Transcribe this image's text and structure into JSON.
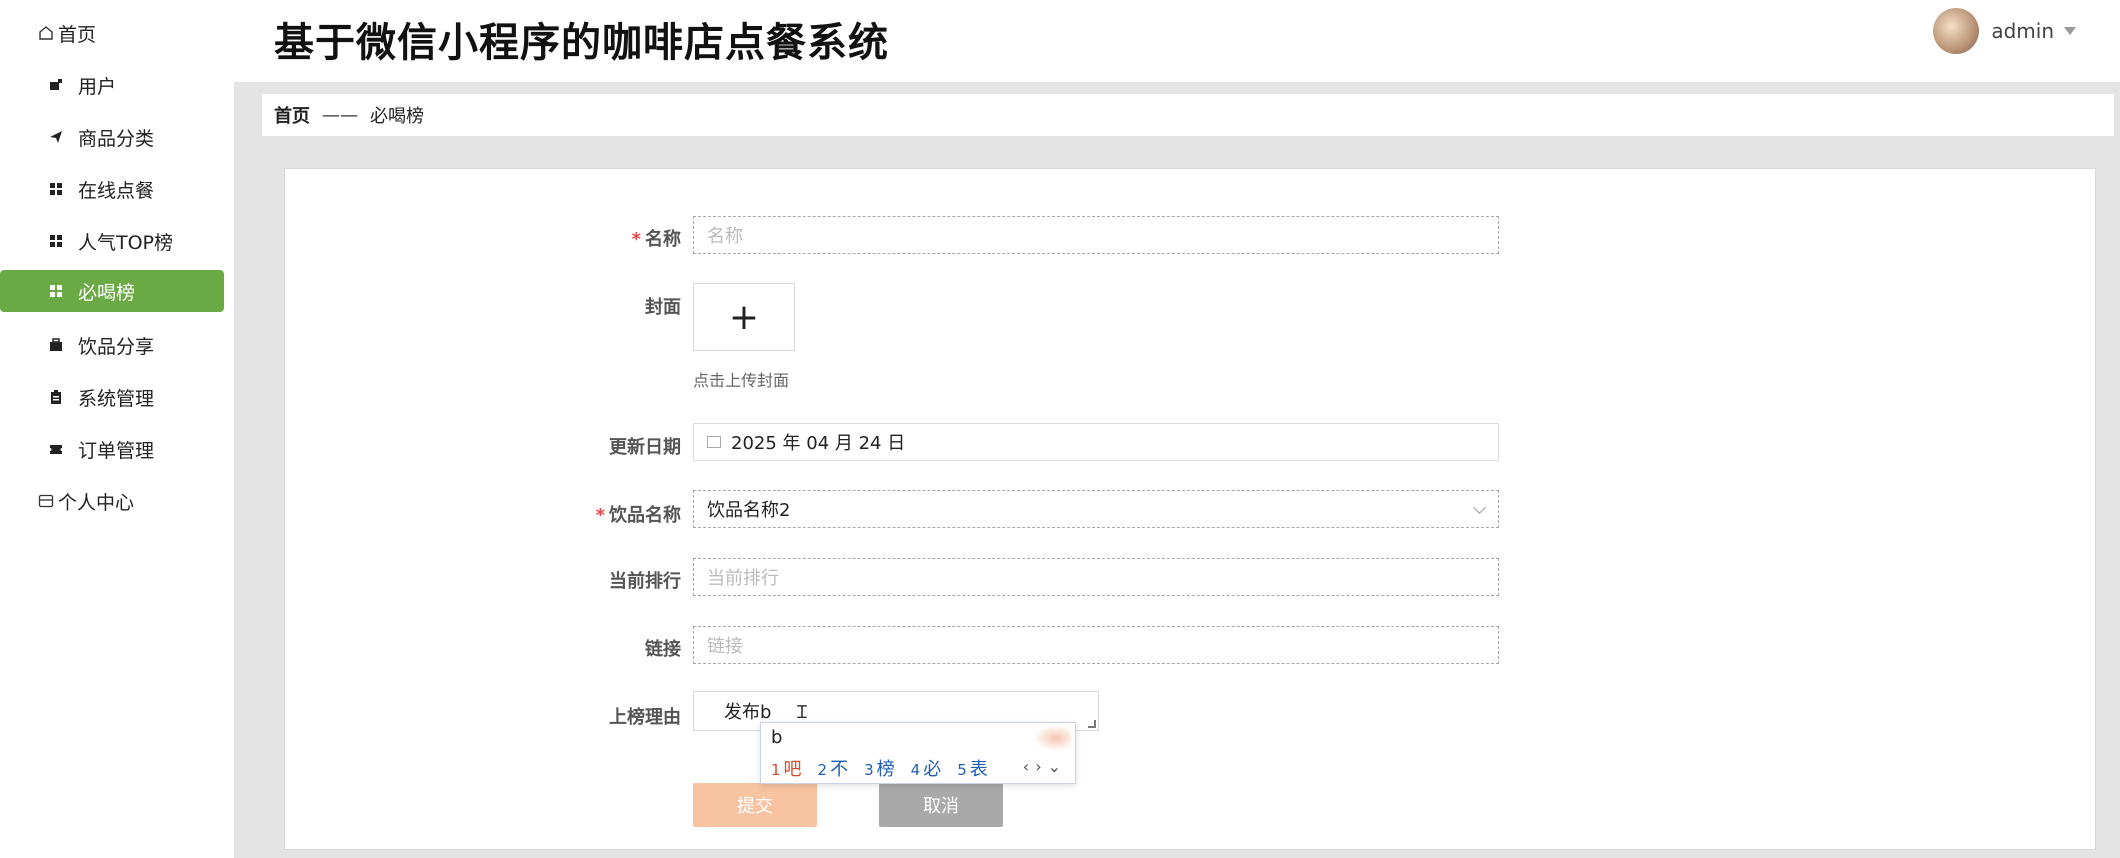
{
  "app": {
    "title": "基于微信小程序的咖啡店点餐系统"
  },
  "user": {
    "name": "admin"
  },
  "sidebar": {
    "items": [
      {
        "label": "首页",
        "icon": "home-icon"
      },
      {
        "label": "用户",
        "icon": "user-icon"
      },
      {
        "label": "商品分类",
        "icon": "send-icon"
      },
      {
        "label": "在线点餐",
        "icon": "grid-icon"
      },
      {
        "label": "人气TOP榜",
        "icon": "grid-icon"
      },
      {
        "label": "必喝榜",
        "icon": "grid-icon",
        "active": true
      },
      {
        "label": "饮品分享",
        "icon": "briefcase-icon"
      },
      {
        "label": "系统管理",
        "icon": "clipboard-icon"
      },
      {
        "label": "订单管理",
        "icon": "ticket-icon"
      },
      {
        "label": "个人中心",
        "icon": "folder-icon"
      }
    ]
  },
  "breadcrumb": {
    "home": "首页",
    "separator": "——",
    "current": "必喝榜"
  },
  "form": {
    "name": {
      "label": "名称",
      "placeholder": "名称"
    },
    "cover": {
      "label": "封面",
      "upload_symbol": "+",
      "hint": "点击上传封面"
    },
    "date": {
      "label": "更新日期",
      "value": "2025 年 04 月 24 日"
    },
    "drink": {
      "label": "饮品名称",
      "value": "饮品名称2"
    },
    "rank": {
      "label": "当前排行",
      "placeholder": "当前排行"
    },
    "link": {
      "label": "链接",
      "placeholder": "链接"
    },
    "reason": {
      "label": "上榜理由",
      "value": "发布b"
    },
    "submit": "提交",
    "cancel": "取消"
  },
  "ime": {
    "input": "b",
    "candidates": [
      {
        "n": "1",
        "text": "吧"
      },
      {
        "n": "2",
        "text": "不"
      },
      {
        "n": "3",
        "text": "榜"
      },
      {
        "n": "4",
        "text": "必"
      },
      {
        "n": "5",
        "text": "表"
      }
    ]
  },
  "colors": {
    "accent": "#6aaa45",
    "submit": "#f7c3a0",
    "cancel": "#a9a9a9",
    "required": "#e64848"
  }
}
